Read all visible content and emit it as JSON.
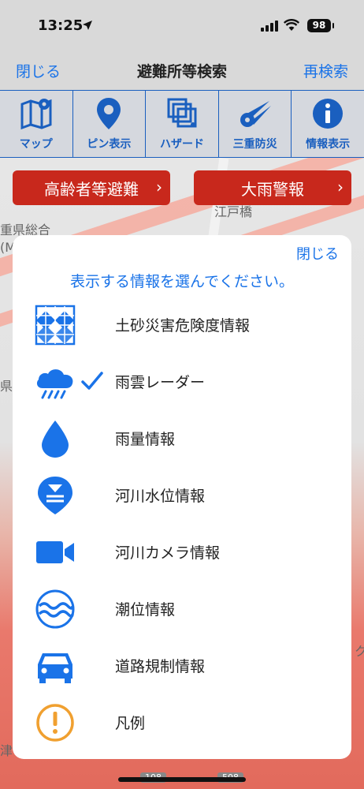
{
  "status_bar": {
    "time": "13:25",
    "battery": "98"
  },
  "nav": {
    "close_label": "閉じる",
    "title": "避難所等検索",
    "research_label": "再検索"
  },
  "toolbar": [
    {
      "label": "マップ",
      "icon": "map-icon"
    },
    {
      "label": "ピン表示",
      "icon": "pin-icon"
    },
    {
      "label": "ハザード",
      "icon": "hazard-layers-icon"
    },
    {
      "label": "三重防災",
      "icon": "mie-bousai-icon"
    },
    {
      "label": "情報表示",
      "icon": "info-icon"
    }
  ],
  "alerts": {
    "elderly": "高齢者等避難",
    "heavy_rain": "大雨警報"
  },
  "map_labels": {
    "bridge": "江戸橋",
    "hall": "重県総合",
    "m": "(M",
    "ken": "県ズ",
    "tsu": "津",
    "k": "ク",
    "r1": "108",
    "r2": "508"
  },
  "modal": {
    "close_label": "閉じる",
    "title": "表示する情報を選んでください。",
    "options": [
      {
        "label": "土砂災害危険度情報",
        "icon": "landslide-grid-icon",
        "checked": false
      },
      {
        "label": "雨雲レーダー",
        "icon": "rain-cloud-icon",
        "checked": true
      },
      {
        "label": "雨量情報",
        "icon": "water-drop-icon",
        "checked": false
      },
      {
        "label": "河川水位情報",
        "icon": "river-level-pin-icon",
        "checked": false
      },
      {
        "label": "河川カメラ情報",
        "icon": "video-camera-icon",
        "checked": false
      },
      {
        "label": "潮位情報",
        "icon": "tide-wave-icon",
        "checked": false
      },
      {
        "label": "道路規制情報",
        "icon": "car-icon",
        "checked": false
      },
      {
        "label": "凡例",
        "icon": "legend-exclamation-icon",
        "checked": false
      }
    ]
  },
  "colors": {
    "accent": "#1a73e8",
    "alert": "#c8281c",
    "legend": "#f0a030"
  }
}
